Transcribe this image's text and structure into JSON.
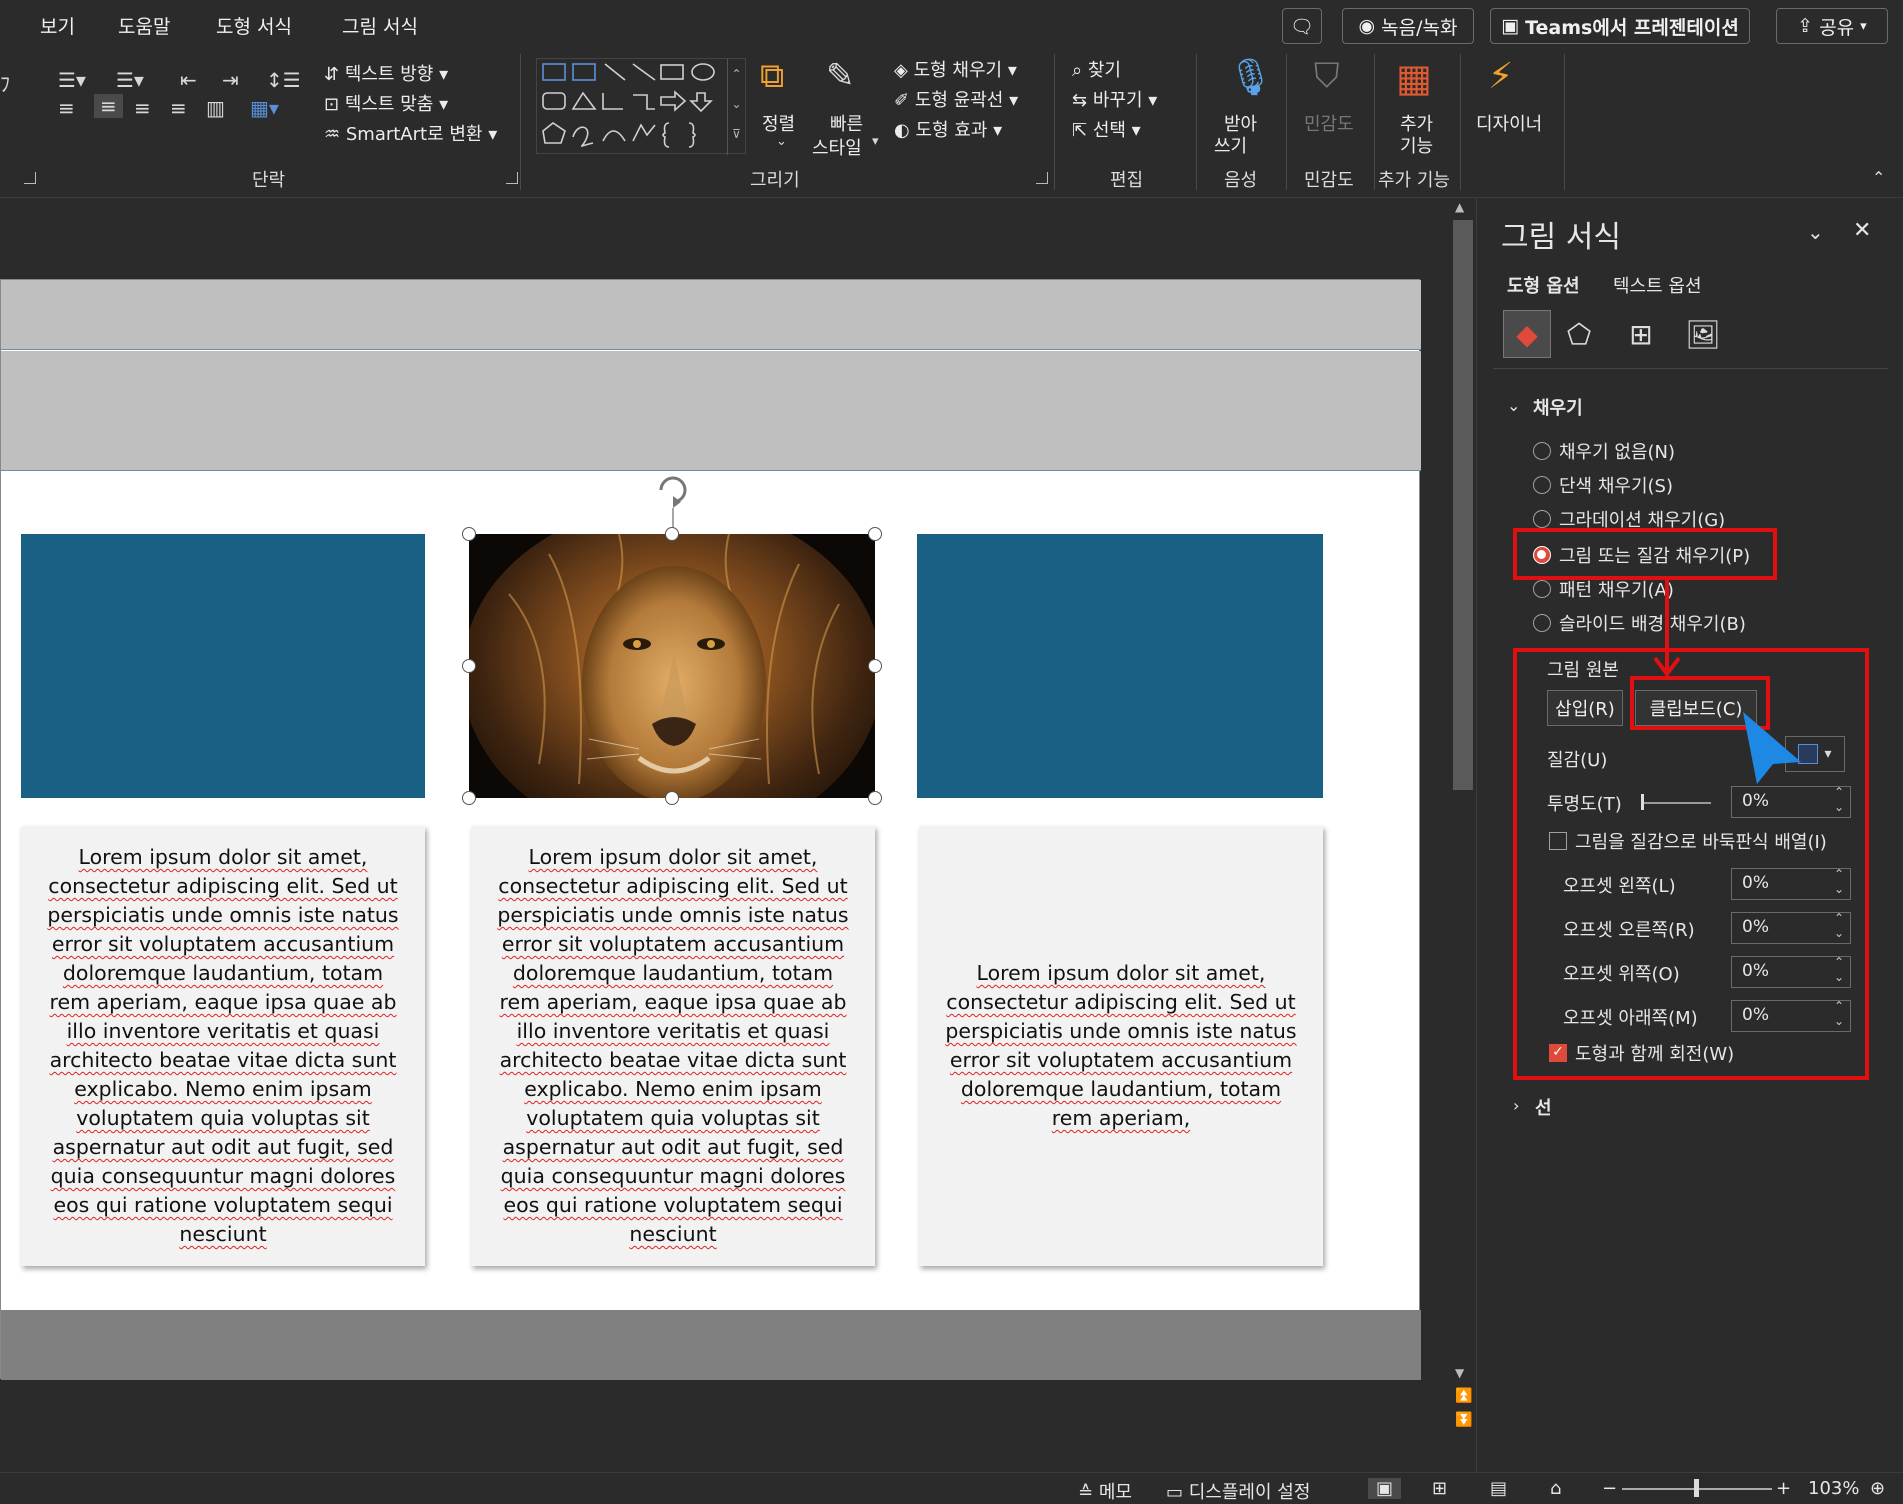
{
  "menu": {
    "items": [
      "보기",
      "도움말",
      "도형 서식",
      "그림 서식"
    ],
    "comment_icon": "comment-icon",
    "record": "녹음/녹화",
    "teams": "Teams에서 프레젠테이션",
    "share": "공유"
  },
  "ribbon": {
    "text_direction": "텍스트 방향",
    "text_align": "텍스트 맞춤",
    "smartart": "SmartArt로 변환",
    "paragraph_label": "단락",
    "arrange": "정렬",
    "quick_style_1": "빠른",
    "quick_style_2": "스타일",
    "shape_fill": "도형 채우기",
    "shape_outline": "도형 윤곽선",
    "shape_effects": "도형 효과",
    "drawing_label": "그리기",
    "find": "찾기",
    "replace": "바꾸기",
    "select": "선택",
    "editing_label": "편집",
    "dictate_1": "받아",
    "dictate_2": "쓰기",
    "voice_label": "음성",
    "sensitivity": "민감도",
    "sensitivity_label": "민감도",
    "addins_1": "추가",
    "addins_2": "기능",
    "addins_label": "추가 기능",
    "designer": "디자이너"
  },
  "slide": {
    "card_text_long": "Lorem ipsum dolor sit amet, consectetur adipiscing elit. Sed ut perspiciatis unde omnis iste natus error sit voluptatem accusantium doloremque laudantium, totam rem aperiam, eaque ipsa quae ab illo inventore veritatis et quasi architecto beatae vitae dicta sunt explicabo. Nemo enim ipsam voluptatem quia voluptas sit aspernatur aut odit aut fugit, sed quia consequuntur magni dolores eos qui ratione voluptatem sequi nesciunt",
    "card_text_short": "Lorem ipsum dolor sit amet, consectetur adipiscing elit. Sed ut perspiciatis unde omnis iste natus error sit voluptatem accusantium doloremque laudantium, totam rem aperiam,",
    "image_subject": "lion-photo",
    "shape_color": "#1a5f84"
  },
  "pane": {
    "title": "그림 서식",
    "tab_shape": "도형 옵션",
    "tab_text": "텍스트 옵션",
    "section_fill": "채우기",
    "fill_none": "채우기 없음(N)",
    "fill_solid": "단색 채우기(S)",
    "fill_gradient": "그라데이션 채우기(G)",
    "fill_picture": "그림 또는 질감 채우기(P)",
    "fill_pattern": "패턴 채우기(A)",
    "fill_slide_bg": "슬라이드 배경 채우기(B)",
    "picture_source": "그림 원본",
    "insert_btn": "삽입(R)",
    "clipboard_btn": "클립보드(C)",
    "texture": "질감(U)",
    "transparency": "투명도(T)",
    "transparency_val": "0%",
    "tile": "그림을 질감으로 바둑판식 배열(I)",
    "offset_left": "오프셋 왼쪽(L)",
    "offset_right": "오프셋 오른쪽(R)",
    "offset_top": "오프셋 위쪽(O)",
    "offset_bottom": "오프셋 아래쪽(M)",
    "offset_left_val": "0%",
    "offset_right_val": "0%",
    "offset_top_val": "0%",
    "offset_bottom_val": "0%",
    "rotate_with_shape": "도형과 함께 회전(W)",
    "section_line": "선",
    "highlight_color": "#e01010"
  },
  "status": {
    "notes": "메모",
    "display": "디스플레이 설정",
    "zoom": "103%"
  }
}
